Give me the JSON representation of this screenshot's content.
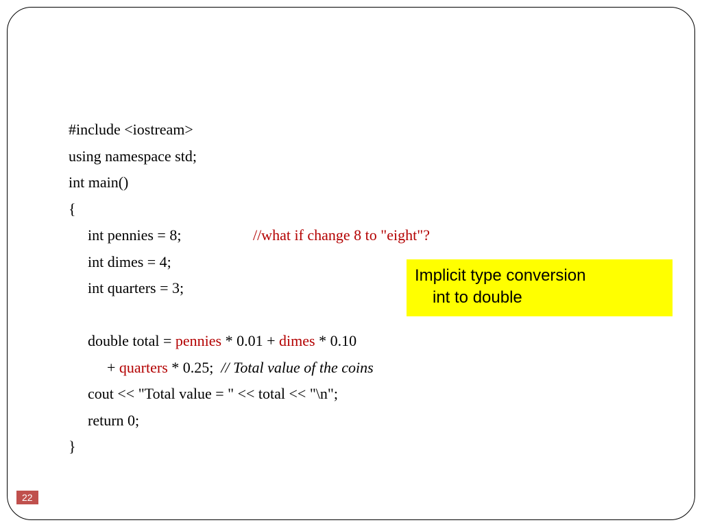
{
  "code": {
    "l1": "#include <iostream>",
    "l2": "using namespace std;",
    "l3": "int main()",
    "l4": "{",
    "l5a": "int pennies = 8;",
    "l5gap": "                   ",
    "l5c": "//what if change 8 to \"eight\"?",
    "l6": "int dimes = 4;",
    "l7": "int quarters = 3;",
    "l8a": "double total = ",
    "l8v1": "pennies",
    "l8b": " * 0.01 + ",
    "l8v2": "dimes",
    "l8c": " * 0.10",
    "l9a": "+ ",
    "l9v": "quarters",
    "l9b": " * 0.25;  ",
    "l9c": "// Total value of the coins",
    "l10": "cout << \"Total value = \" << total << \"\\n\";",
    "l11": "return 0;",
    "l12": "}"
  },
  "callout": {
    "line1": "Implicit type conversion",
    "line2": "int to double"
  },
  "page_number": "22"
}
